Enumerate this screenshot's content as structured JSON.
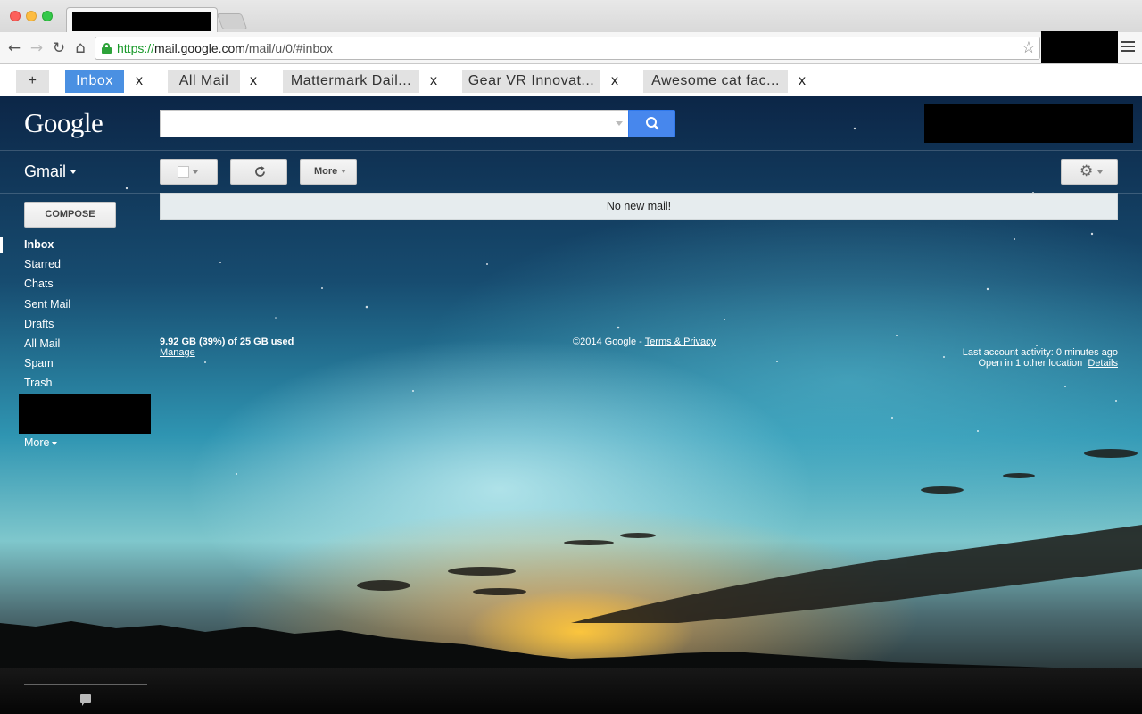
{
  "browser": {
    "url_scheme": "https://",
    "url_host": "mail.google.com",
    "url_path": "/mail/u/0/#inbox",
    "nav": {
      "back": "←",
      "forward": "→",
      "reload": "↻",
      "home": "⌂",
      "star": "☆"
    }
  },
  "tab_extension": {
    "add_label": "+",
    "close_label": "x",
    "tabs": [
      {
        "label": "Inbox",
        "active": true
      },
      {
        "label": "All Mail",
        "active": false
      },
      {
        "label": "Mattermark Dail...",
        "active": false
      },
      {
        "label": "Gear VR Innovat...",
        "active": false
      },
      {
        "label": "Awesome cat fac...",
        "active": false
      }
    ]
  },
  "gmail": {
    "logo": "Google",
    "app_label": "Gmail",
    "toolbar": {
      "more_label": "More",
      "gear": "⚙"
    },
    "compose_label": "COMPOSE",
    "nav_items": [
      "Inbox",
      "Starred",
      "Chats",
      "Sent Mail",
      "Drafts",
      "All Mail",
      "Spam",
      "Trash"
    ],
    "more_label": "More",
    "empty_message": "No new mail!",
    "storage": {
      "usage": "9.92 GB (39%) of 25 GB used",
      "manage": "Manage"
    },
    "copyright": {
      "text": "©2014 Google - ",
      "link": "Terms & Privacy"
    },
    "activity": {
      "last": "Last account activity: 0 minutes ago",
      "other": "Open in 1 other location",
      "details": "Details"
    }
  },
  "colors": {
    "active_tab": "#4a90e2",
    "search_button": "#4787ed",
    "url_green": "#1a9a2b"
  }
}
